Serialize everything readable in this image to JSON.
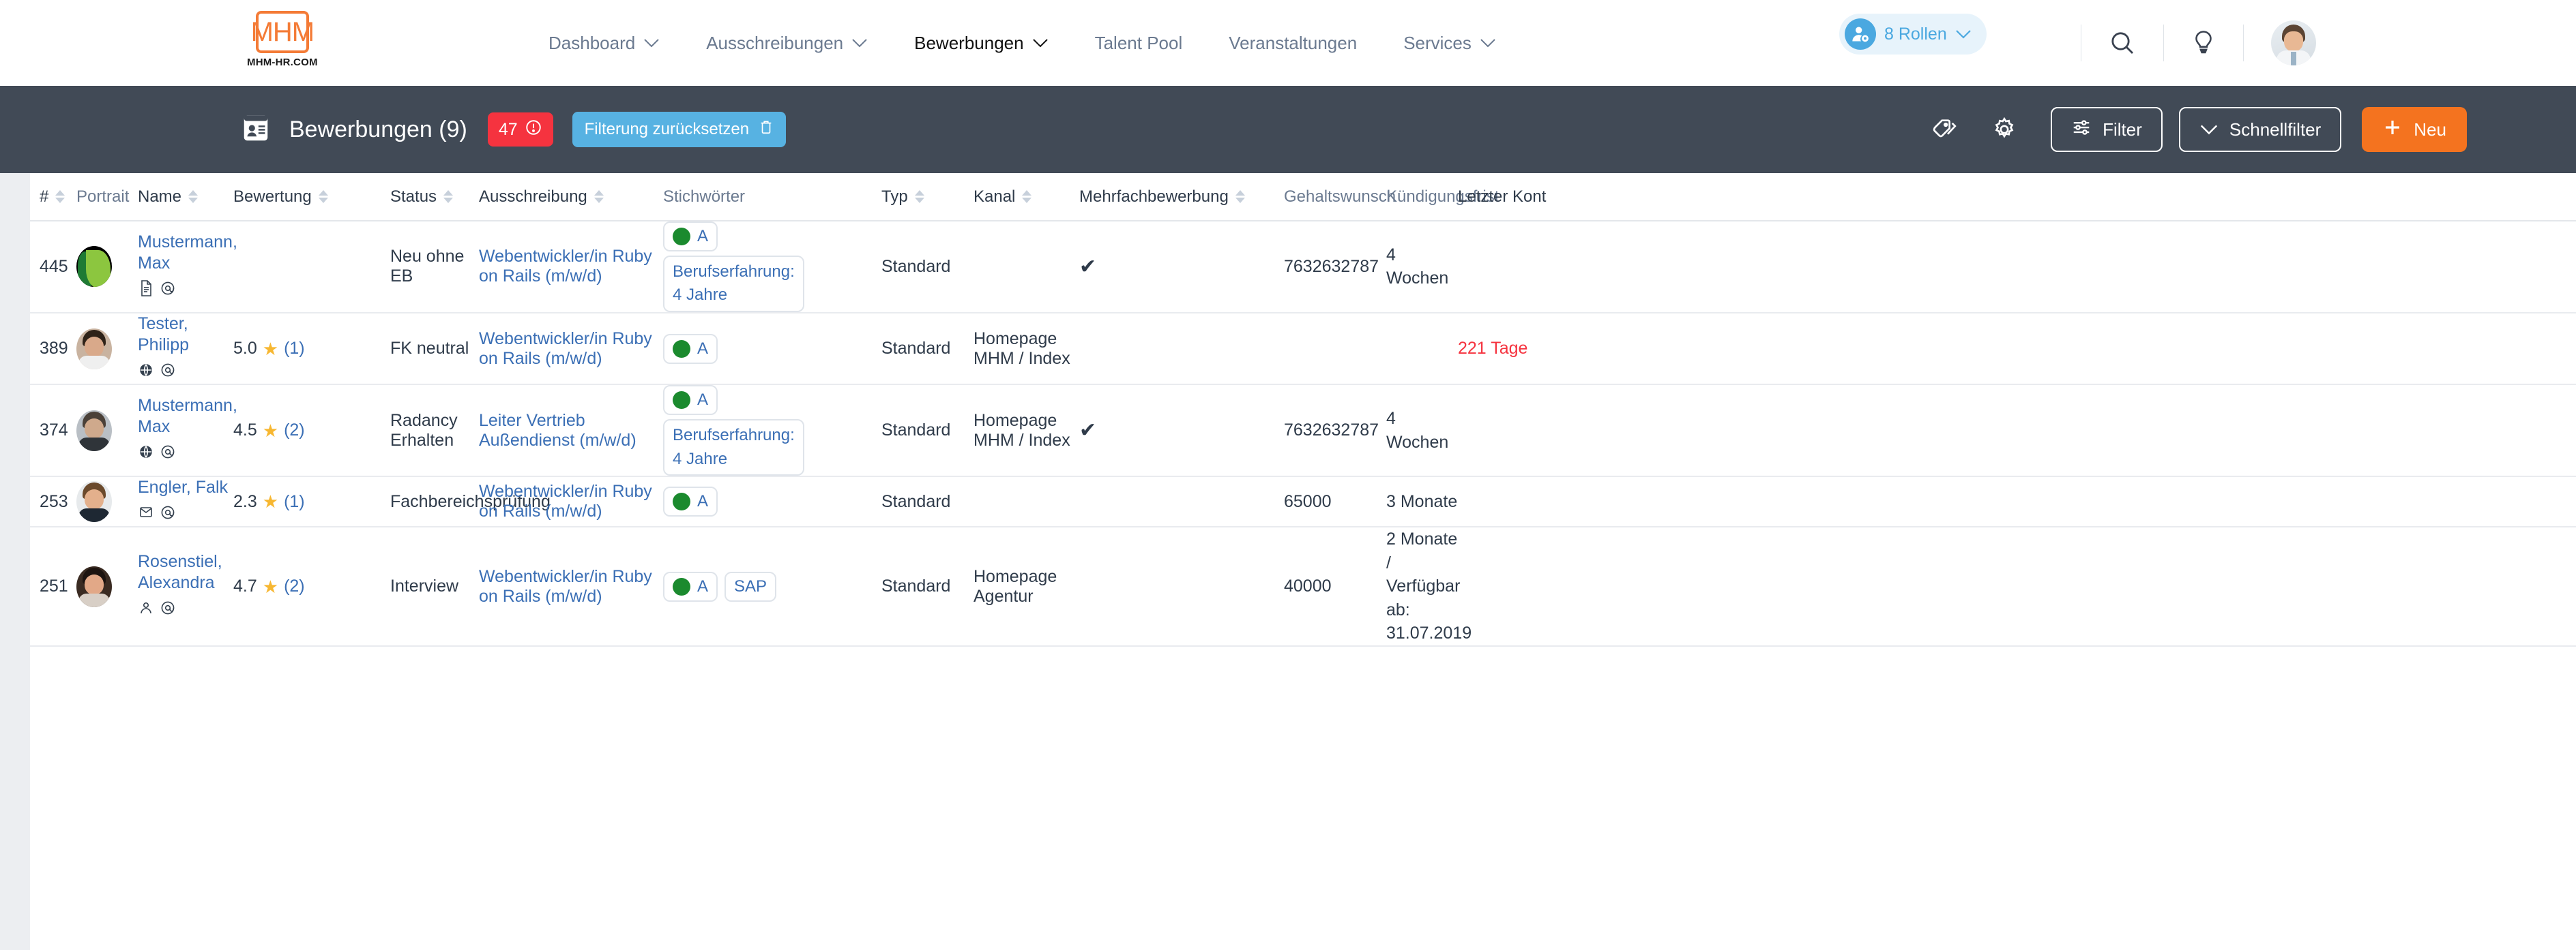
{
  "brand": {
    "logo_text": "MHM",
    "logo_sub": "MHM-HR.COM",
    "accent": "#f47b36"
  },
  "topnav": {
    "links": [
      {
        "label": "Dashboard",
        "caret": true,
        "active": false
      },
      {
        "label": "Ausschreibungen",
        "caret": true,
        "active": false
      },
      {
        "label": "Bewerbungen",
        "caret": true,
        "active": true
      },
      {
        "label": "Talent Pool",
        "caret": false,
        "active": false
      },
      {
        "label": "Veranstaltungen",
        "caret": false,
        "active": false
      },
      {
        "label": "Services",
        "caret": true,
        "active": false
      }
    ],
    "roles_label": "8 Rollen",
    "icons": [
      "roles-user-icon",
      "search-icon",
      "lightbulb-icon",
      "user-avatar"
    ]
  },
  "subheader": {
    "title": "Bewerbungen (9)",
    "badge_count": "47",
    "reset_label": "Filterung zurücksetzen",
    "filter_label": "Filter",
    "quickfilter_label": "Schnellfilter",
    "new_label": "Neu",
    "badge_color": "#f5333f",
    "reset_color": "#57b2e2",
    "new_color": "#f4731f",
    "bar_color": "#414a56"
  },
  "table": {
    "columns": [
      {
        "key": "num",
        "label": "#",
        "sortable": true,
        "muted": false
      },
      {
        "key": "portrait",
        "label": "Portrait",
        "sortable": false,
        "muted": true
      },
      {
        "key": "name",
        "label": "Name",
        "sortable": true,
        "muted": false
      },
      {
        "key": "rating",
        "label": "Bewertung",
        "sortable": true,
        "muted": false
      },
      {
        "key": "status",
        "label": "Status",
        "sortable": true,
        "muted": false
      },
      {
        "key": "posting",
        "label": "Ausschreibung",
        "sortable": true,
        "muted": false
      },
      {
        "key": "keywords",
        "label": "Stichwörter",
        "sortable": false,
        "muted": true
      },
      {
        "key": "type",
        "label": "Typ",
        "sortable": true,
        "muted": false
      },
      {
        "key": "channel",
        "label": "Kanal",
        "sortable": true,
        "muted": false
      },
      {
        "key": "multi",
        "label": "Mehrfachbewerbung",
        "sortable": true,
        "muted": false
      },
      {
        "key": "salary",
        "label": "Gehaltswunsch",
        "sortable": false,
        "muted": true
      },
      {
        "key": "notice",
        "label": "Kündigungsfrist",
        "sortable": false,
        "muted": true
      },
      {
        "key": "contact",
        "label": "Letzter Kont",
        "sortable": false,
        "muted": false
      }
    ],
    "rows": [
      {
        "num": "445",
        "portrait_style": "leaf",
        "name": "Mustermann, Max",
        "mini_icons": [
          "document-icon",
          "at-icon"
        ],
        "rating": "",
        "rating_count": "",
        "status": "Neu ohne EB",
        "posting": "Webentwickler/in Ruby on Rails (m/w/d)",
        "keywords": [
          {
            "type": "dot",
            "label": "A"
          },
          {
            "type": "multi",
            "line1": "Berufserfahrung:",
            "line2": "4 Jahre"
          }
        ],
        "type": "Standard",
        "channel": "",
        "multi": "✔",
        "salary": "7632632787",
        "notice": "4 Wochen",
        "contact": "",
        "contact_danger": false
      },
      {
        "num": "389",
        "portrait_style": "man1",
        "name": "Tester, Philipp",
        "mini_icons": [
          "globe-icon",
          "at-icon"
        ],
        "rating": "5.0",
        "rating_count": "(1)",
        "status": "FK neutral",
        "posting": "Webentwickler/in Ruby on Rails (m/w/d)",
        "keywords": [
          {
            "type": "dot",
            "label": "A"
          }
        ],
        "type": "Standard",
        "channel": "Homepage MHM / Index",
        "multi": "",
        "salary": "",
        "notice": "",
        "contact": "221 Tage",
        "contact_danger": true
      },
      {
        "num": "374",
        "portrait_style": "man2",
        "name": "Mustermann, Max",
        "mini_icons": [
          "globe-icon",
          "at-icon"
        ],
        "rating": "4.5",
        "rating_count": "(2)",
        "status": "Radancy Erhalten",
        "posting": "Leiter Vertrieb Außendienst (m/w/d)",
        "keywords": [
          {
            "type": "dot",
            "label": "A"
          },
          {
            "type": "multi",
            "line1": "Berufserfahrung:",
            "line2": "4 Jahre"
          }
        ],
        "type": "Standard",
        "channel": "Homepage MHM / Index",
        "multi": "✔",
        "salary": "7632632787",
        "notice": "4 Wochen",
        "contact": "",
        "contact_danger": false
      },
      {
        "num": "253",
        "portrait_style": "man3",
        "name": "Engler, Falk",
        "mini_icons": [
          "envelope-icon",
          "at-icon"
        ],
        "rating": "2.3",
        "rating_count": "(1)",
        "status": "Fachbereichsprüfung",
        "posting": "Webentwickler/in Ruby on Rails (m/w/d)",
        "keywords": [
          {
            "type": "dot",
            "label": "A"
          }
        ],
        "type": "Standard",
        "channel": "",
        "multi": "",
        "salary": "65000",
        "notice": "3 Monate",
        "contact": "",
        "contact_danger": false
      },
      {
        "num": "251",
        "portrait_style": "woman1",
        "name": "Rosenstiel, Alexandra",
        "mini_icons": [
          "person-icon",
          "at-icon"
        ],
        "rating": "4.7",
        "rating_count": "(2)",
        "status": "Interview",
        "posting": "Webentwickler/in Ruby on Rails (m/w/d)",
        "keywords": [
          {
            "type": "dot",
            "label": "A"
          },
          {
            "type": "plain",
            "label": "SAP"
          }
        ],
        "type": "Standard",
        "channel": "Homepage Agentur",
        "multi": "",
        "salary": "40000",
        "notice": "2 Monate /\nVerfügbar ab:\n31.07.2019",
        "contact": "",
        "contact_danger": false
      }
    ]
  }
}
